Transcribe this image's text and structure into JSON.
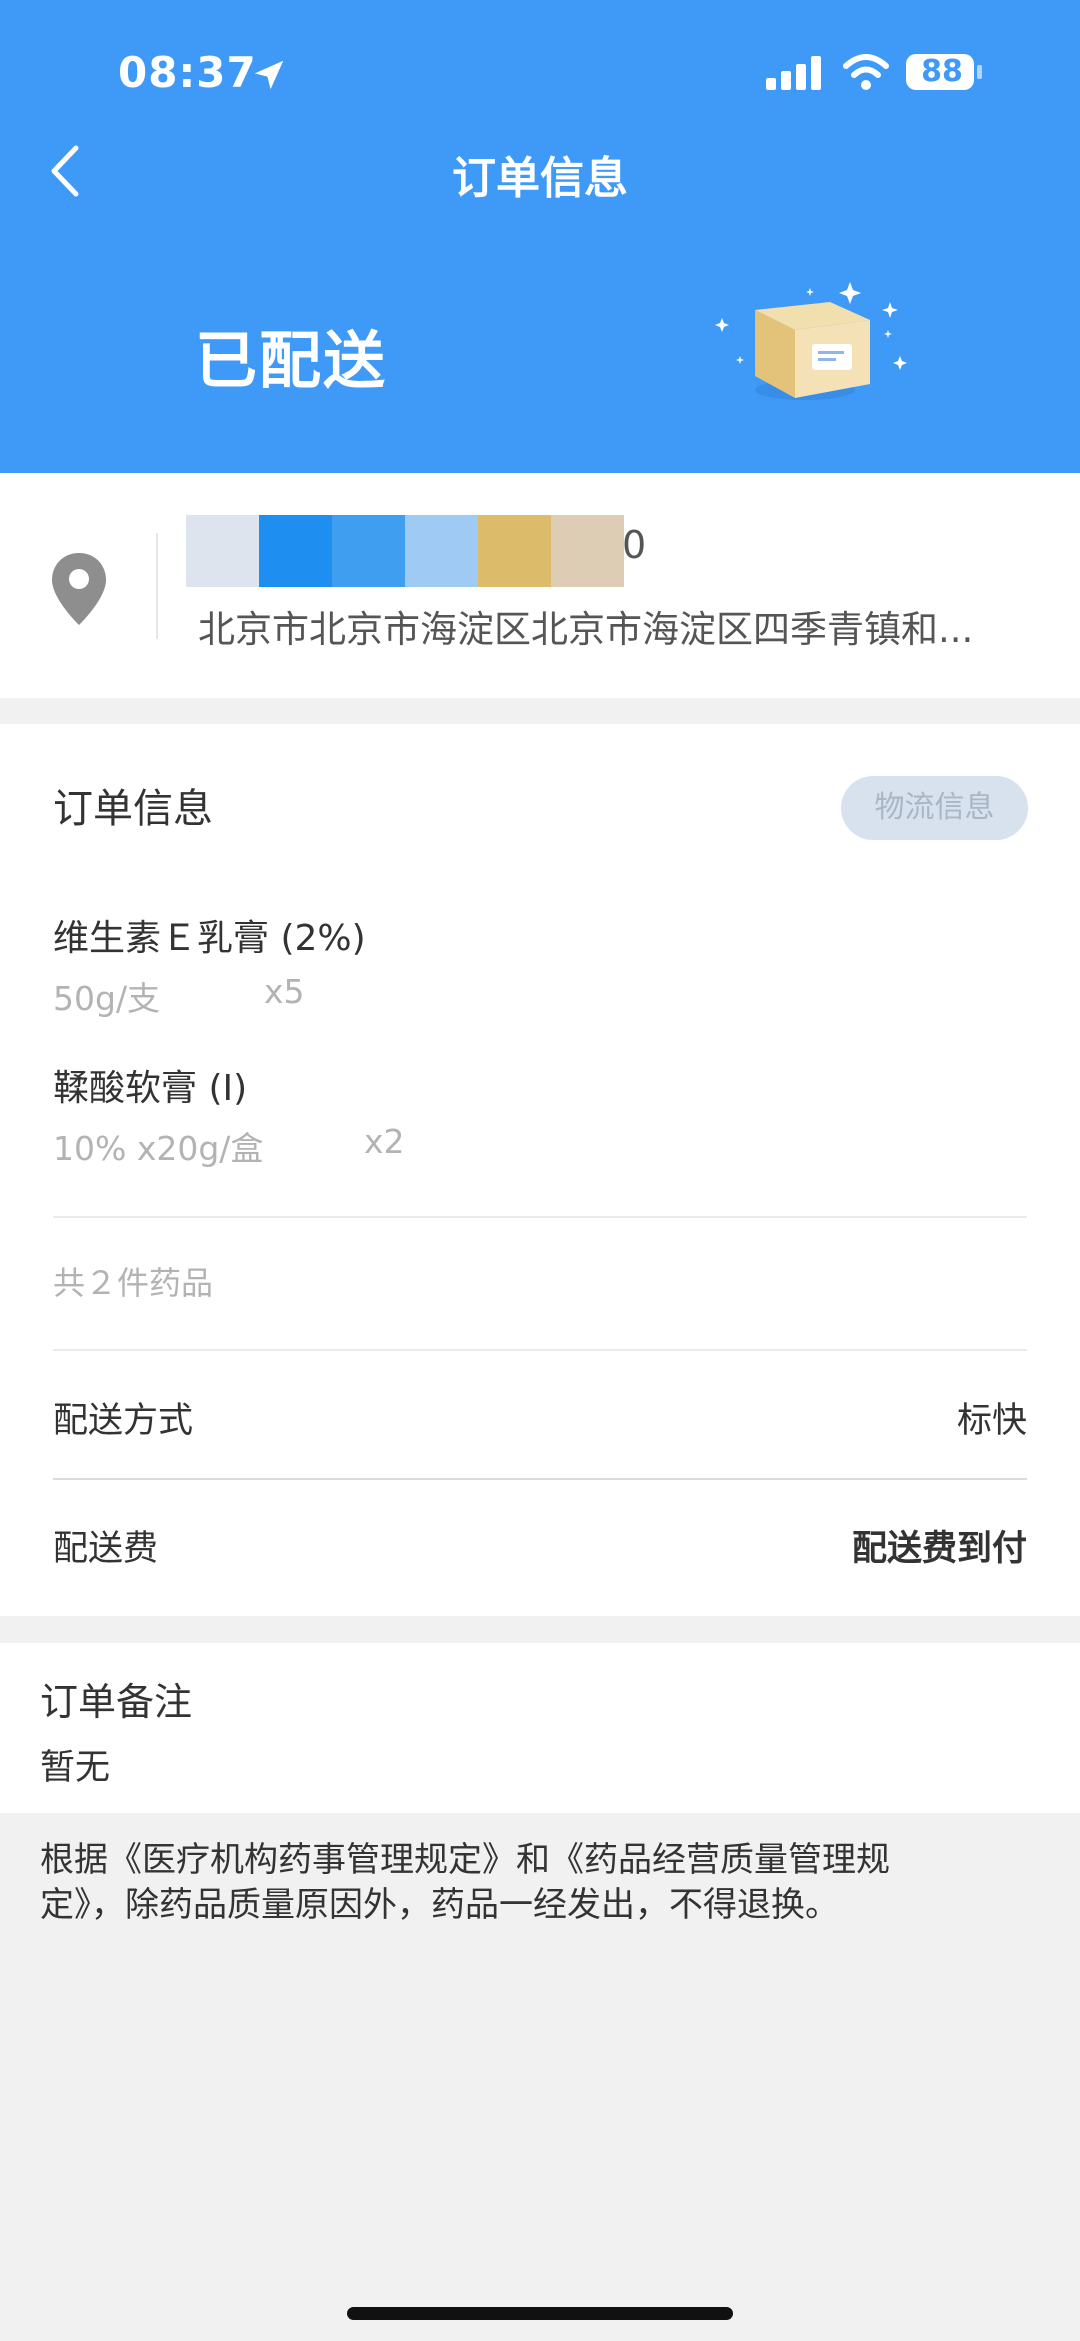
{
  "status_bar": {
    "time": "08:37",
    "battery": "88",
    "icons": [
      "location-arrow-icon",
      "cellular-signal-icon",
      "wifi-icon",
      "battery-icon"
    ]
  },
  "nav": {
    "back_icon": "chevron-left-icon",
    "title": "订单信息"
  },
  "order_status": {
    "title": "已配送",
    "illustration": "package-box-icon"
  },
  "address": {
    "icon": "location-pin-icon",
    "contact_tail": "0",
    "text": "北京市北京市海淀区北京市海淀区四季青镇和..."
  },
  "order_info": {
    "title": "订单信息",
    "logistics_button": "物流信息",
    "items": [
      {
        "name": "维生素Ｅ乳膏 (2%)",
        "spec": "50g/支",
        "qty": "x5"
      },
      {
        "name": "鞣酸软膏 (I)",
        "spec": "10% x20g/盒",
        "qty": "x2"
      }
    ],
    "total": "共２件药品",
    "delivery_method": {
      "label": "配送方式",
      "value": "标快"
    },
    "delivery_fee": {
      "label": "配送费",
      "value": "配送费到付"
    }
  },
  "remark": {
    "title": "订单备注",
    "text": "暂无"
  },
  "notice": {
    "line1": "根据《医疗机构药事管理规定》和《药品经营质量管理规",
    "line2": "定》，除药品质量原因外，药品一经发出，不得退换。"
  },
  "colors": {
    "header_blue": "#3f9af7",
    "logistics_bg": "#d8e2ee",
    "redaction_blocks": [
      "#dde4ee",
      "#1e8ef0",
      "#3f9ef0",
      "#9ecaf3",
      "#dcbc6a",
      "#dccdb4"
    ]
  }
}
